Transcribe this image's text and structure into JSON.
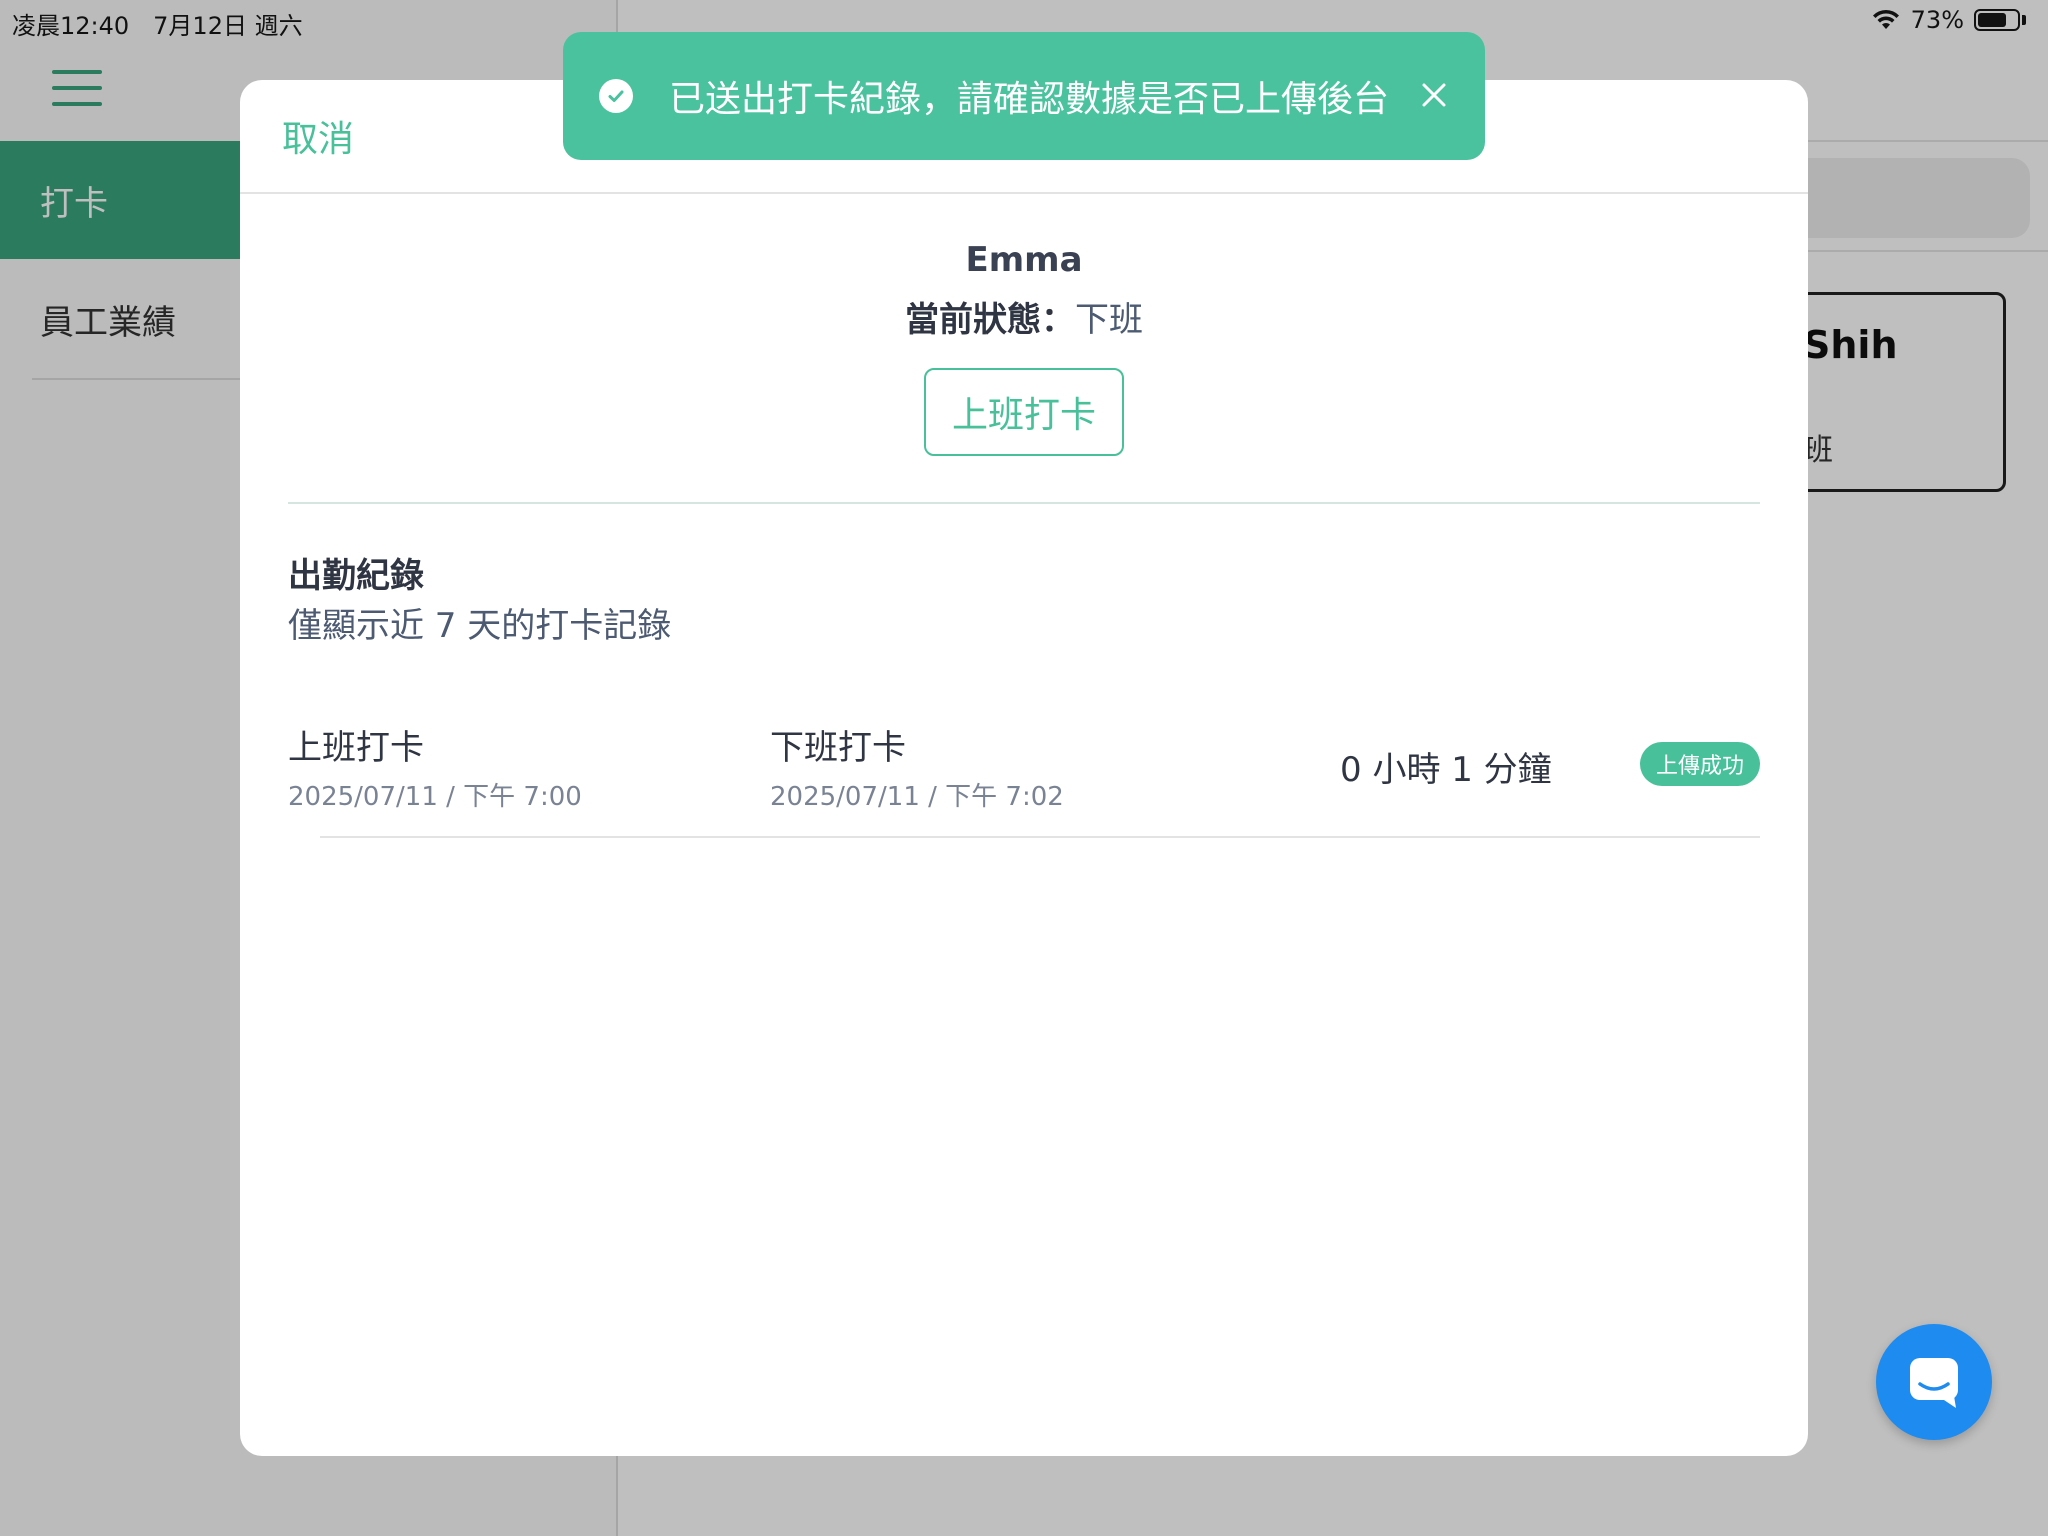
{
  "status_bar": {
    "time_date": "凌晨12:40　7月12日 週六",
    "battery": "73%",
    "battery_level": 0.73
  },
  "sidebar": {
    "items": [
      {
        "label": "打卡",
        "active": true
      },
      {
        "label": "員工業績",
        "active": false
      }
    ]
  },
  "background_card": {
    "name": "Shih",
    "status": "班"
  },
  "modal": {
    "cancel_label": "取消",
    "employee_name": "Emma",
    "status_label": "當前狀態：",
    "status_value": "下班",
    "clock_in_label": "上班打卡",
    "records_title": "出勤紀錄",
    "records_subtitle": "僅顯示近 7 天的打卡記錄",
    "records": [
      {
        "clock_in_label": "上班打卡",
        "clock_in_time": "2025/07/11 / 下午 7:00",
        "clock_out_label": "下班打卡",
        "clock_out_time": "2025/07/11 / 下午 7:02",
        "duration": "0 小時 1 分鐘",
        "badge": "上傳成功"
      }
    ]
  },
  "toast": {
    "message": "已送出打卡紀錄，請確認數據是否已上傳後台",
    "icon": "check-circle-icon"
  },
  "colors": {
    "accent": "#48c09a",
    "sidebar_active": "#3aa57e",
    "toast_bg": "#4ac29e",
    "chat_button": "#1d8bf0"
  }
}
